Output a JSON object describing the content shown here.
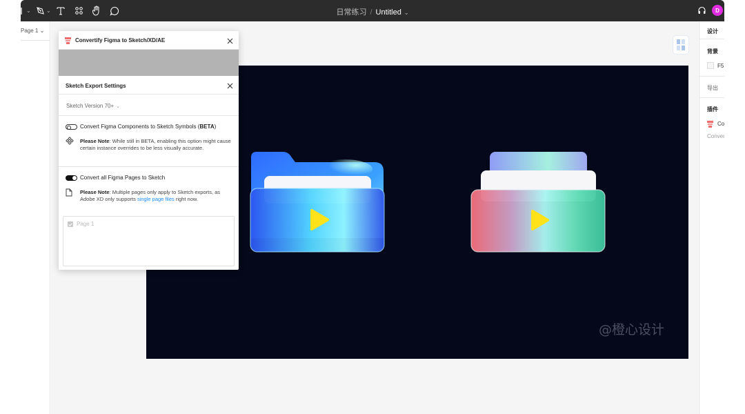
{
  "toolbar": {
    "project": "日常练习",
    "separator": "/",
    "file_name": "Untitled",
    "caret": "⌄",
    "avatar_initial": "D",
    "avatar_color": "#e02de0"
  },
  "left_panel": {
    "page_select": "Page 1 ⌄"
  },
  "right_panel": {
    "tab_design": "设计",
    "background_label": "背景",
    "background_value": "F5",
    "export_label": "导出",
    "plugin_label": "插件",
    "plugin_name": "Co",
    "plugin_sub": "Conver"
  },
  "plugin_window": {
    "title": "Convertify Figma to Sketch/XD/AE",
    "settings_title": "Sketch Export Settings",
    "sketch_version": "Sketch Version 70+",
    "option1": {
      "label_pre": "Convert Figma Components to Sketch Symbols (",
      "label_bold": "BETA",
      "label_post": ")",
      "enabled": false,
      "note_bold": "Please Note",
      "note_text": ": While still in BETA, enabling this option might cause certain instance overrides to be less visually accurate."
    },
    "option2": {
      "label": "Convert all Figma Pages to Sketch",
      "enabled": true,
      "note_bold": "Please Note",
      "note_text": ": Multiple pages only apply to Sketch exports, as Adobe XD only supports ",
      "note_link": "single page files",
      "note_end": " right now."
    },
    "pages": [
      {
        "name": "Page 1",
        "checked": true
      }
    ]
  },
  "canvas": {
    "frame_color": "#04081a",
    "canvas_color": "#f5f5f5",
    "watermark": "@橙心设计"
  }
}
